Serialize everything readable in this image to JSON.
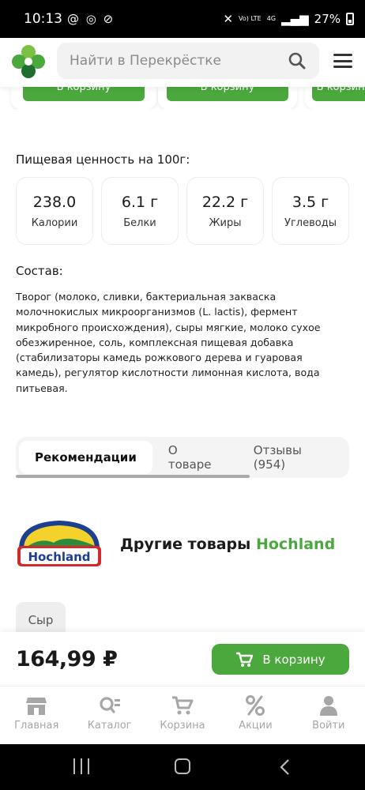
{
  "status_bar": {
    "time": "10:13",
    "notifications": "@ ◎ ⊘",
    "signal_top": "Vo) LTE",
    "net_top": "4G",
    "battery": "27%"
  },
  "header": {
    "search_placeholder": "Найти в Перекрёстке"
  },
  "carousel": {
    "button_label": "В корзину"
  },
  "nutrition": {
    "title": "Пищевая ценность на 100г:",
    "items": [
      {
        "value": "238.0",
        "label": "Калории"
      },
      {
        "value": "6.1 г",
        "label": "Белки"
      },
      {
        "value": "22.2 г",
        "label": "Жиры"
      },
      {
        "value": "3.5 г",
        "label": "Углеводы"
      }
    ]
  },
  "composition": {
    "title": "Состав:",
    "text": "Творог (молоко, сливки, бактериальная закваска молочнокислых микроорганизмов (L. lactis), фермент микробного происхождения), сыры мягкие, молоко сухое обезжиренное, соль, комплексная пищевая добавка (стабилизаторы камедь рожкового дерева и гуаровая камедь), регулятор кислотности лимонная кислота, вода питьевая."
  },
  "tabs": [
    {
      "label": "Рекомендации",
      "active": true
    },
    {
      "label": "О товаре",
      "active": false
    },
    {
      "label": "Отзывы (954)",
      "active": false
    }
  ],
  "brand": {
    "logo_text": "Hochland",
    "title_prefix": "Другие товары",
    "title_brand": "Hochland"
  },
  "chip": {
    "label": "Сыр"
  },
  "buy_bar": {
    "price": "164,99 ₽",
    "cart_label": "В корзину"
  },
  "bottom_nav": [
    {
      "label": "Главная",
      "icon": "store-icon"
    },
    {
      "label": "Каталог",
      "icon": "catalog-search-icon"
    },
    {
      "label": "Корзина",
      "icon": "cart-icon"
    },
    {
      "label": "Акции",
      "icon": "percent-icon"
    },
    {
      "label": "Войти",
      "icon": "user-icon"
    }
  ],
  "colors": {
    "brand_green": "#4aa83c",
    "nav_gray": "#a6a6a6"
  }
}
